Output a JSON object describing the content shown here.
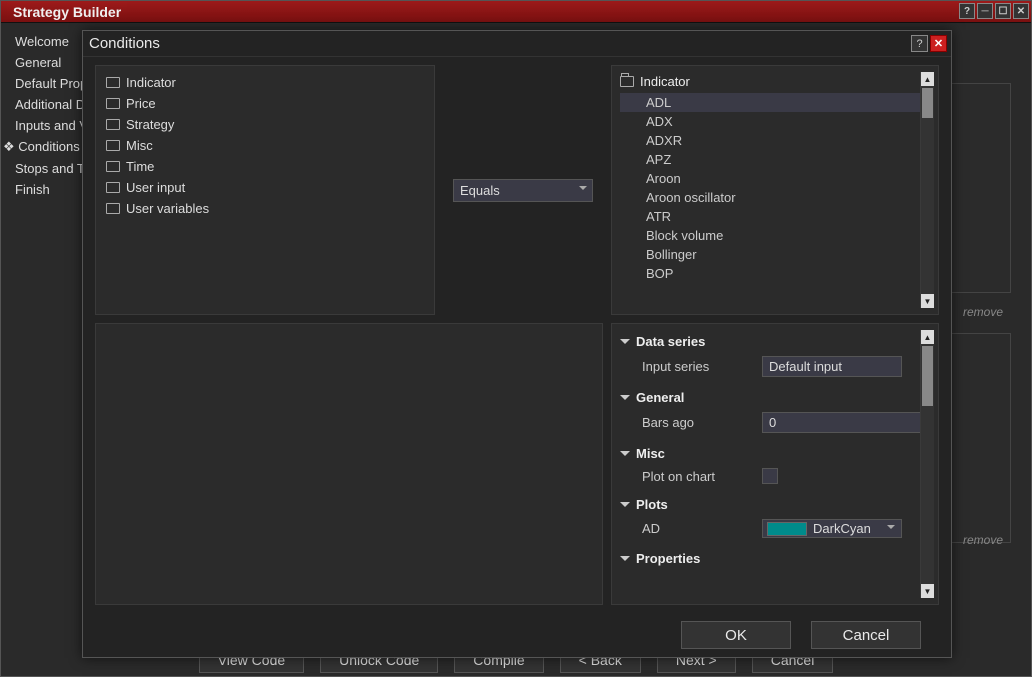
{
  "window": {
    "title": "Strategy Builder"
  },
  "sidebar": {
    "items": [
      {
        "label": "Welcome"
      },
      {
        "label": "General"
      },
      {
        "label": "Default Properties"
      },
      {
        "label": "Additional Data"
      },
      {
        "label": "Inputs and Variables"
      },
      {
        "label": "Conditions and Actions",
        "active": true,
        "display": "Conditions"
      },
      {
        "label": "Stops and Targets"
      },
      {
        "label": "Finish"
      }
    ]
  },
  "background": {
    "remove1": "remove",
    "remove2": "remove",
    "buttons": {
      "view_code": "View Code",
      "unlock_code": "Unlock Code",
      "compile": "Compile",
      "back": "< Back",
      "next": "Next >",
      "cancel": "Cancel"
    }
  },
  "modal": {
    "title": "Conditions",
    "ok": "OK",
    "cancel": "Cancel",
    "left_tree": [
      "Indicator",
      "Price",
      "Strategy",
      "Misc",
      "Time",
      "User input",
      "User variables"
    ],
    "operator": {
      "value": "Equals",
      "options": [
        "Equals"
      ]
    },
    "right_tree": {
      "header": "Indicator",
      "items": [
        "ADL",
        "ADX",
        "ADXR",
        "APZ",
        "Aroon",
        "Aroon oscillator",
        "ATR",
        "Block volume",
        "Bollinger",
        "BOP"
      ],
      "selected": "ADL"
    },
    "properties": {
      "data_series": {
        "header": "Data series",
        "rows": [
          {
            "label": "Input series",
            "value": "Default input",
            "type": "text"
          }
        ]
      },
      "general": {
        "header": "General",
        "rows": [
          {
            "label": "Bars ago",
            "value": "0",
            "type": "text"
          }
        ]
      },
      "misc": {
        "header": "Misc",
        "rows": [
          {
            "label": "Plot on chart",
            "value": "",
            "type": "checkbox"
          }
        ]
      },
      "plots": {
        "header": "Plots",
        "rows": [
          {
            "label": "AD",
            "value": "DarkCyan",
            "type": "color",
            "swatch": "#008b8b"
          }
        ]
      },
      "properties": {
        "header": "Properties",
        "rows": []
      }
    }
  }
}
